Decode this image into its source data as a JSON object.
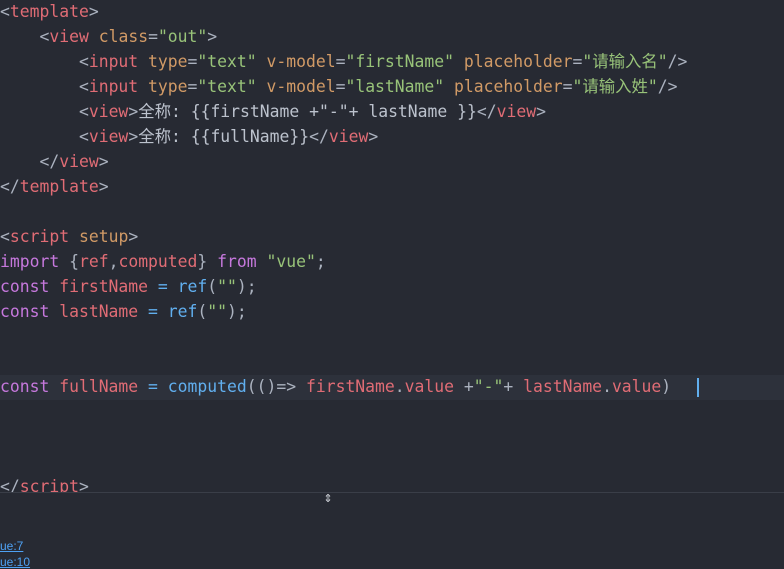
{
  "editor": {
    "lines": [
      [
        [
          "c-punct",
          "<"
        ],
        [
          "c-tag",
          "template"
        ],
        [
          "c-punct",
          ">"
        ]
      ],
      [
        [
          "c-text",
          "    "
        ],
        [
          "c-punct",
          "<"
        ],
        [
          "c-tag",
          "view"
        ],
        [
          "c-text",
          " "
        ],
        [
          "c-attr",
          "class"
        ],
        [
          "c-punct",
          "="
        ],
        [
          "c-str",
          "\"out\""
        ],
        [
          "c-punct",
          ">"
        ]
      ],
      [
        [
          "c-text",
          "        "
        ],
        [
          "c-punct",
          "<"
        ],
        [
          "c-tag",
          "input"
        ],
        [
          "c-text",
          " "
        ],
        [
          "c-attr",
          "type"
        ],
        [
          "c-punct",
          "="
        ],
        [
          "c-str",
          "\"text\""
        ],
        [
          "c-text",
          " "
        ],
        [
          "c-attr",
          "v-model"
        ],
        [
          "c-punct",
          "="
        ],
        [
          "c-str",
          "\"firstName\""
        ],
        [
          "c-text",
          " "
        ],
        [
          "c-attr",
          "placeholder"
        ],
        [
          "c-punct",
          "="
        ],
        [
          "c-str",
          "\"请输入名\""
        ],
        [
          "c-punct",
          "/>"
        ]
      ],
      [
        [
          "c-text",
          "        "
        ],
        [
          "c-punct",
          "<"
        ],
        [
          "c-tag",
          "input"
        ],
        [
          "c-text",
          " "
        ],
        [
          "c-attr",
          "type"
        ],
        [
          "c-punct",
          "="
        ],
        [
          "c-str",
          "\"text\""
        ],
        [
          "c-text",
          " "
        ],
        [
          "c-attr",
          "v-model"
        ],
        [
          "c-punct",
          "="
        ],
        [
          "c-str",
          "\"lastName\""
        ],
        [
          "c-text",
          " "
        ],
        [
          "c-attr",
          "placeholder"
        ],
        [
          "c-punct",
          "="
        ],
        [
          "c-str",
          "\"请输入姓\""
        ],
        [
          "c-punct",
          "/>"
        ]
      ],
      [
        [
          "c-text",
          "        "
        ],
        [
          "c-punct",
          "<"
        ],
        [
          "c-tag",
          "view"
        ],
        [
          "c-punct",
          ">"
        ],
        [
          "c-text",
          "全称: {{firstName +\"-\"+ lastName }}"
        ],
        [
          "c-punct",
          "</"
        ],
        [
          "c-tag",
          "view"
        ],
        [
          "c-punct",
          ">"
        ]
      ],
      [
        [
          "c-text",
          "        "
        ],
        [
          "c-punct",
          "<"
        ],
        [
          "c-tag",
          "view"
        ],
        [
          "c-punct",
          ">"
        ],
        [
          "c-text",
          "全称: {{fullName}}"
        ],
        [
          "c-punct",
          "</"
        ],
        [
          "c-tag",
          "view"
        ],
        [
          "c-punct",
          ">"
        ]
      ],
      [
        [
          "c-text",
          "    "
        ],
        [
          "c-punct",
          "</"
        ],
        [
          "c-tag",
          "view"
        ],
        [
          "c-punct",
          ">"
        ]
      ],
      [
        [
          "c-punct",
          "</"
        ],
        [
          "c-tag",
          "template"
        ],
        [
          "c-punct",
          ">"
        ]
      ],
      [],
      [
        [
          "c-punct",
          "<"
        ],
        [
          "c-tag",
          "script"
        ],
        [
          "c-text",
          " "
        ],
        [
          "c-attr",
          "setup"
        ],
        [
          "c-punct",
          ">"
        ]
      ],
      [
        [
          "c-kw",
          "import"
        ],
        [
          "c-text",
          " "
        ],
        [
          "c-punct",
          "{"
        ],
        [
          "c-var",
          "ref"
        ],
        [
          "c-punct",
          ","
        ],
        [
          "c-var",
          "computed"
        ],
        [
          "c-punct",
          "}"
        ],
        [
          "c-text",
          " "
        ],
        [
          "c-kw",
          "from"
        ],
        [
          "c-text",
          " "
        ],
        [
          "c-str",
          "\"vue\""
        ],
        [
          "c-punct",
          ";"
        ]
      ],
      [
        [
          "c-kw",
          "const"
        ],
        [
          "c-text",
          " "
        ],
        [
          "c-var",
          "firstName"
        ],
        [
          "c-text",
          " "
        ],
        [
          "c-fn",
          "="
        ],
        [
          "c-text",
          " "
        ],
        [
          "c-fn",
          "ref"
        ],
        [
          "c-punct",
          "("
        ],
        [
          "c-str",
          "\"\""
        ],
        [
          "c-punct",
          ");"
        ]
      ],
      [
        [
          "c-kw",
          "const"
        ],
        [
          "c-text",
          " "
        ],
        [
          "c-var",
          "lastName"
        ],
        [
          "c-text",
          " "
        ],
        [
          "c-fn",
          "="
        ],
        [
          "c-text",
          " "
        ],
        [
          "c-fn",
          "ref"
        ],
        [
          "c-punct",
          "("
        ],
        [
          "c-str",
          "\"\""
        ],
        [
          "c-punct",
          ");"
        ]
      ],
      [],
      [],
      [
        [
          "c-kw",
          "const"
        ],
        [
          "c-text",
          " "
        ],
        [
          "c-var",
          "fullName"
        ],
        [
          "c-text",
          " "
        ],
        [
          "c-fn",
          "="
        ],
        [
          "c-text",
          " "
        ],
        [
          "c-fn",
          "computed"
        ],
        [
          "c-punct",
          "(()=>"
        ],
        [
          "c-text",
          " "
        ],
        [
          "c-var",
          "firstName"
        ],
        [
          "c-punct",
          "."
        ],
        [
          "c-var",
          "value"
        ],
        [
          "c-text",
          " "
        ],
        [
          "c-punct",
          "+"
        ],
        [
          "c-str",
          "\"-\""
        ],
        [
          "c-punct",
          "+"
        ],
        [
          "c-text",
          " "
        ],
        [
          "c-var",
          "lastName"
        ],
        [
          "c-punct",
          "."
        ],
        [
          "c-var",
          "value"
        ],
        [
          "c-punct",
          ")"
        ]
      ],
      [],
      [],
      [],
      [
        [
          "c-punct",
          "</"
        ],
        [
          "c-tag",
          "script"
        ],
        [
          "c-punct",
          ">"
        ]
      ]
    ]
  },
  "panel": {
    "link1": "ue:7",
    "link2": "ue:10"
  },
  "colors": {
    "background": "#272a33",
    "tag": "#e06c75",
    "attribute": "#d19a66",
    "string": "#98c379",
    "keyword": "#c678dd",
    "function": "#61afef"
  }
}
